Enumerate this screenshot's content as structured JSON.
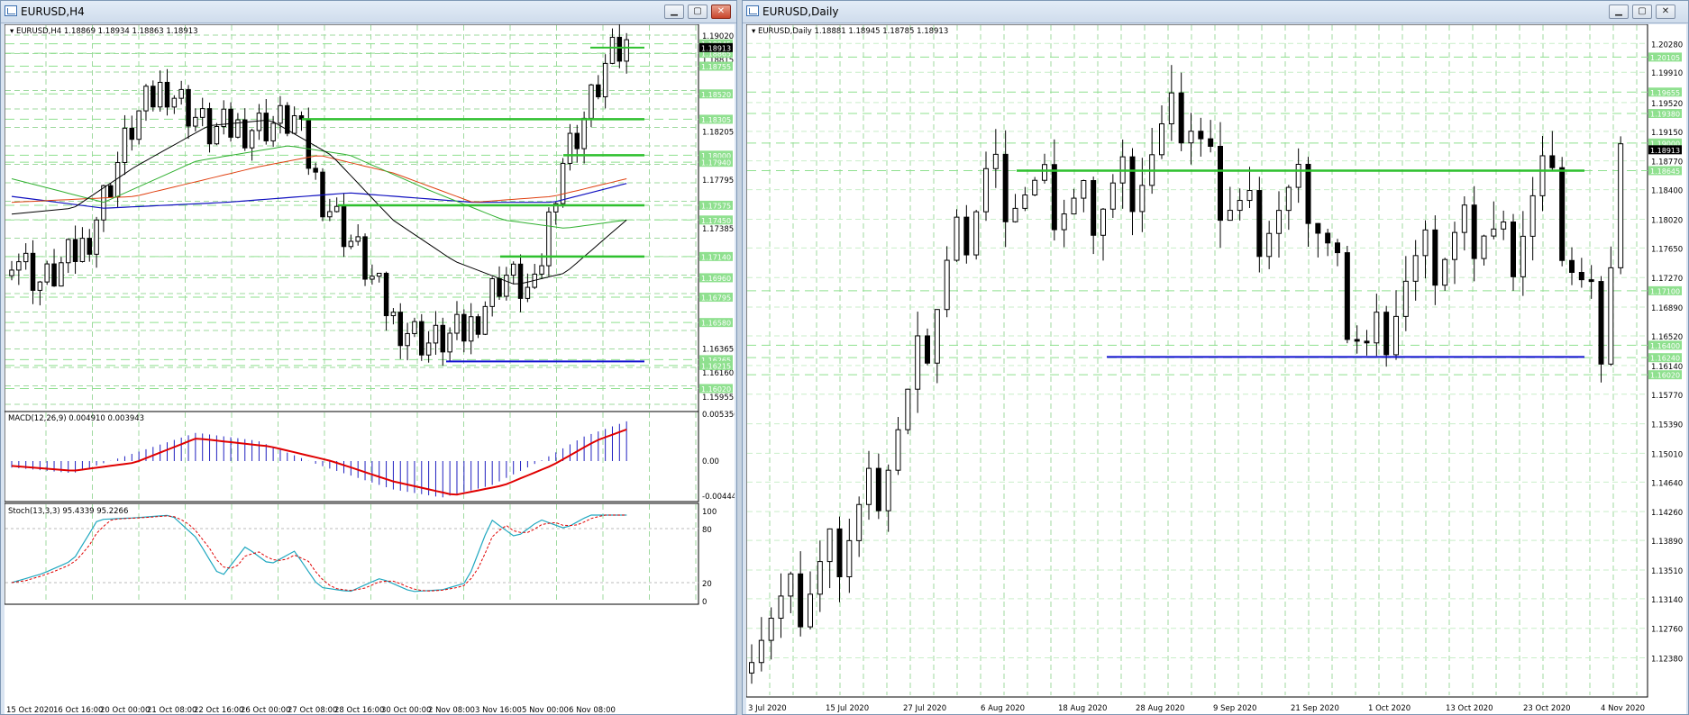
{
  "windows": {
    "h4": {
      "title": "EURUSD,H4"
    },
    "daily": {
      "title": "EURUSD,Daily"
    }
  },
  "window_controls": {
    "minimize": "▁",
    "maximize": "▢",
    "close": "✕"
  },
  "colors": {
    "green_line": "#2ec02e",
    "blue_line": "#1010d0",
    "macd_hist": "#2020c0",
    "macd_signal": "#e00000",
    "stoch_main": "#20a8c0",
    "stoch_signal": "#e00000",
    "level_label_bg": "#8fe08f",
    "current_price_bg": "#000000"
  },
  "chart_data": [
    {
      "type": "candlestick",
      "symbol": "EURUSD",
      "timeframe": "H4",
      "header": "EURUSD,H4  1.18869 1.18934 1.18863 1.18913",
      "ylim": [
        1.1584,
        1.1908
      ],
      "price_ticks": [
        "1.19020",
        "1.18815",
        "1.18205",
        "1.17795",
        "1.17385",
        "1.16365",
        "1.16160",
        "1.15955"
      ],
      "level_labels": [
        "1.18945",
        "1.18865",
        "1.18755",
        "1.18520",
        "1.18305",
        "1.18000",
        "1.17940",
        "1.17575",
        "1.17450",
        "1.17140",
        "1.16960",
        "1.16795",
        "1.16580",
        "1.16265",
        "1.16215",
        "1.16020"
      ],
      "current_price": "1.18913",
      "x_labels": [
        "15 Oct 2020",
        "16 Oct 16:00",
        "20 Oct 00:00",
        "21 Oct 08:00",
        "22 Oct 16:00",
        "26 Oct 00:00",
        "27 Oct 08:00",
        "28 Oct 16:00",
        "30 Oct 00:00",
        "2 Nov 08:00",
        "3 Nov 16:00",
        "5 Nov 00:00",
        "6 Nov 08:00"
      ],
      "macd": {
        "header": "MACD(12,26,9) 0.004910 0.003943",
        "ticks": [
          "0.005356",
          "0.00",
          "-0.004448"
        ]
      },
      "stoch": {
        "header": "Stoch(13,3,3) 95.4339 95.2266",
        "ticks": [
          "100",
          "80",
          "20",
          "0"
        ]
      }
    },
    {
      "type": "candlestick",
      "symbol": "EURUSD",
      "timeframe": "Daily",
      "header": "EURUSD,Daily  1.18881 1.18945 1.18785 1.18913",
      "ylim": [
        1.119,
        1.2048
      ],
      "price_ticks": [
        "1.20280",
        "1.19910",
        "1.19520",
        "1.19150",
        "1.18770",
        "1.18400",
        "1.18020",
        "1.17650",
        "1.17270",
        "1.16890",
        "1.16520",
        "1.16140",
        "1.15770",
        "1.15390",
        "1.15010",
        "1.14640",
        "1.14260",
        "1.13890",
        "1.13510",
        "1.13140",
        "1.12760",
        "1.12380"
      ],
      "level_labels": [
        "1.20105",
        "1.19655",
        "1.19380",
        "1.19000",
        "1.18645",
        "1.17100",
        "1.16400",
        "1.16240",
        "1.16020"
      ],
      "current_price": "1.18913",
      "x_labels": [
        "3 Jul 2020",
        "15 Jul 2020",
        "27 Jul 2020",
        "6 Aug 2020",
        "18 Aug 2020",
        "28 Aug 2020",
        "9 Sep 2020",
        "21 Sep 2020",
        "1 Oct 2020",
        "13 Oct 2020",
        "23 Oct 2020",
        "4 Nov 2020"
      ]
    }
  ]
}
